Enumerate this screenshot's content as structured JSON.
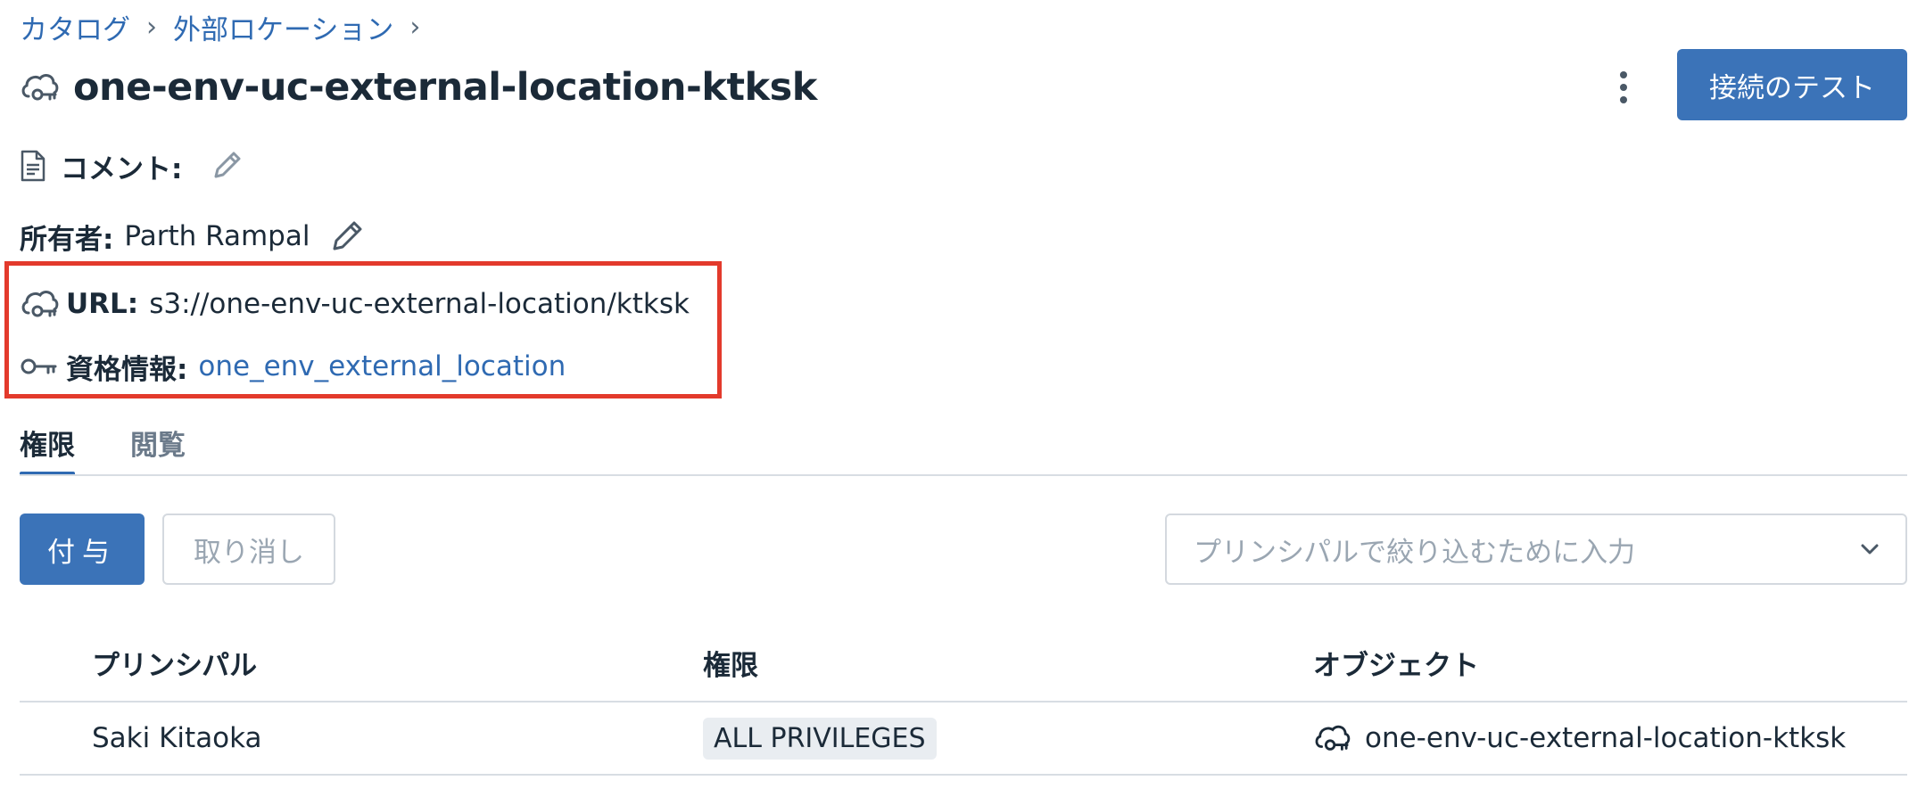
{
  "breadcrumb": {
    "items": [
      "カタログ",
      "外部ロケーション"
    ],
    "separator": "›"
  },
  "header": {
    "title": "one-env-uc-external-location-ktksk",
    "test_connection_label": "接続のテスト"
  },
  "details": {
    "comment_label": "コメント:",
    "owner_label": "所有者:",
    "owner_value": "Parth Rampal",
    "url_label": "URL:",
    "url_value": "s3://one-env-uc-external-location/ktksk",
    "credential_label": "資格情報:",
    "credential_value": "one_env_external_location"
  },
  "tabs": [
    {
      "label": "権限",
      "active": true
    },
    {
      "label": "閲覧",
      "active": false
    }
  ],
  "actions": {
    "grant_label": "付与",
    "revoke_label": "取り消し",
    "filter_placeholder": "プリンシパルで絞り込むために入力"
  },
  "table": {
    "headers": [
      "プリンシパル",
      "権限",
      "オブジェクト"
    ],
    "rows": [
      {
        "principal": "Saki Kitaoka",
        "privilege": "ALL PRIVILEGES",
        "object": "one-env-uc-external-location-ktksk"
      }
    ]
  },
  "colors": {
    "accent": "#3b73b8",
    "link": "#2f6ab2",
    "highlight": "#e33a2c"
  },
  "icons": [
    "cloud-key-icon",
    "document-icon",
    "pencil-icon",
    "key-icon",
    "kebab-menu-icon",
    "chevron-down-icon"
  ]
}
